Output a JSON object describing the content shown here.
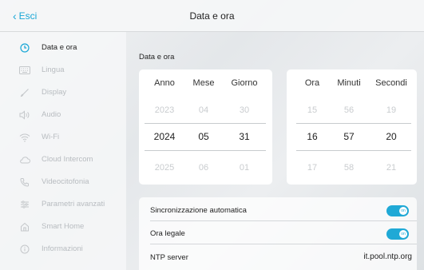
{
  "header": {
    "back_label": "Esci",
    "title": "Data e ora"
  },
  "sidebar": {
    "items": [
      {
        "label": "Data e ora",
        "icon": "clock-icon",
        "active": true
      },
      {
        "label": "Lingua",
        "icon": "keyboard-icon"
      },
      {
        "label": "Display",
        "icon": "brush-icon"
      },
      {
        "label": "Audio",
        "icon": "speaker-icon"
      },
      {
        "label": "Wi-Fi",
        "icon": "wifi-icon"
      },
      {
        "label": "Cloud Intercom",
        "icon": "cloud-icon"
      },
      {
        "label": "Videocitofonia",
        "icon": "phone-icon"
      },
      {
        "label": "Parametri avanzati",
        "icon": "sliders-icon"
      },
      {
        "label": "Smart Home",
        "icon": "home-icon"
      },
      {
        "label": "Informazioni",
        "icon": "info-icon"
      }
    ]
  },
  "main": {
    "section_title": "Data e ora",
    "date_picker": {
      "headers": [
        "Anno",
        "Mese",
        "Giorno"
      ],
      "prev": [
        "2023",
        "04",
        "30"
      ],
      "selected": [
        "2024",
        "05",
        "31"
      ],
      "next": [
        "2025",
        "06",
        "01"
      ]
    },
    "time_picker": {
      "headers": [
        "Ora",
        "Minuti",
        "Secondi"
      ],
      "prev": [
        "15",
        "56",
        "19"
      ],
      "selected": [
        "16",
        "57",
        "20"
      ],
      "next": [
        "17",
        "58",
        "21"
      ]
    },
    "settings": {
      "auto_sync_label": "Sincronizzazione automatica",
      "auto_sync_state": "on",
      "dst_label": "Ora legale",
      "dst_state": "on",
      "ntp_label": "NTP server",
      "ntp_value": "it.pool.ntp.org"
    }
  },
  "colors": {
    "accent": "#1fa9d6",
    "inactive_text": "#b8bcc0"
  }
}
